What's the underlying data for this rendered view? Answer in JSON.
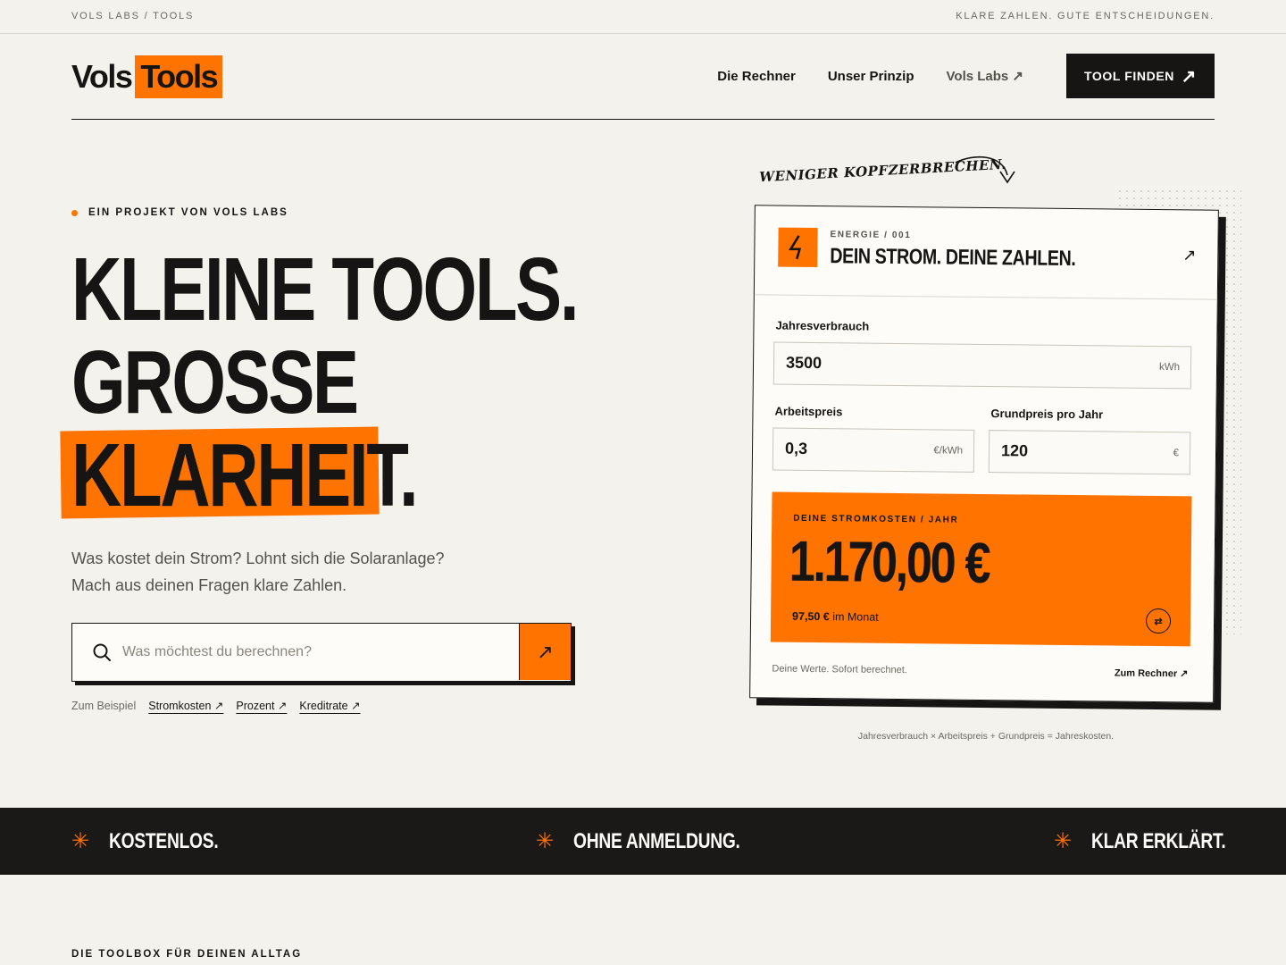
{
  "topbar": {
    "left": "VOLS LABS / TOOLS",
    "right": "KLARE ZAHLEN. GUTE ENTSCHEIDUNGEN."
  },
  "header": {
    "logo_part1": "Vols",
    "logo_part2": "Tools",
    "nav": [
      "Die Rechner",
      "Unser Prinzip",
      "Vols Labs ↗"
    ],
    "cta_label": "TOOL FINDEN",
    "cta_arrow": "↗"
  },
  "hero": {
    "eyebrow": "EIN PROJEKT VON VOLS LABS",
    "headline": [
      "KLEINE TOOLS.",
      "GROSSE",
      "KLARHEIT."
    ],
    "lead_1": "Was kostet dein Strom? Lohnt sich die Solaranlage?",
    "lead_2": "Mach aus deinen Fragen klare Zahlen.",
    "search_placeholder": "Was möchtest du berechnen?",
    "search_button": "↗",
    "examples_label": "Zum Beispiel",
    "examples": [
      "Stromkosten ↗",
      "Prozent ↗",
      "Kreditrate ↗"
    ]
  },
  "card": {
    "scribble": "WENIGER KOPFZERBRECHEN.",
    "kicker": "ENERGIE / 001",
    "title": "DEIN STROM. DEINE ZAHLEN.",
    "ext": "↗",
    "fields": {
      "jahresverbrauch": {
        "label": "Jahresverbrauch",
        "value": "3500",
        "unit": "kWh"
      },
      "arbeitspreis": {
        "label": "Arbeitspreis",
        "value": "0,3",
        "unit": "€/kWh"
      },
      "grundpreis": {
        "label": "Grundpreis pro Jahr",
        "value": "120",
        "unit": "€"
      }
    },
    "result": {
      "label": "DEINE STROMKOSTEN / JAHR",
      "value": "1.170,00 €",
      "month_value": "97,50 €",
      "month_suffix": " im Monat"
    },
    "footer_left": "Deine Werte. Sofort berechnet.",
    "footer_right": "Zum Rechner ↗"
  },
  "formula": "Jahresverbrauch × Arbeitspreis + Grundpreis = Jahreskosten.",
  "band": [
    "KOSTENLOS.",
    "OHNE ANMELDUNG.",
    "KLAR ERKLÄRT."
  ],
  "section_eyebrow": "DIE TOOLBOX FÜR DEINEN ALLTAG",
  "colors": {
    "accent": "#ff7300",
    "ink": "#161513",
    "background": "#f4f2ed"
  },
  "icons": [
    "search-icon",
    "bolt-icon",
    "arrow-up-right-icon",
    "swap-icon",
    "star-icon"
  ]
}
